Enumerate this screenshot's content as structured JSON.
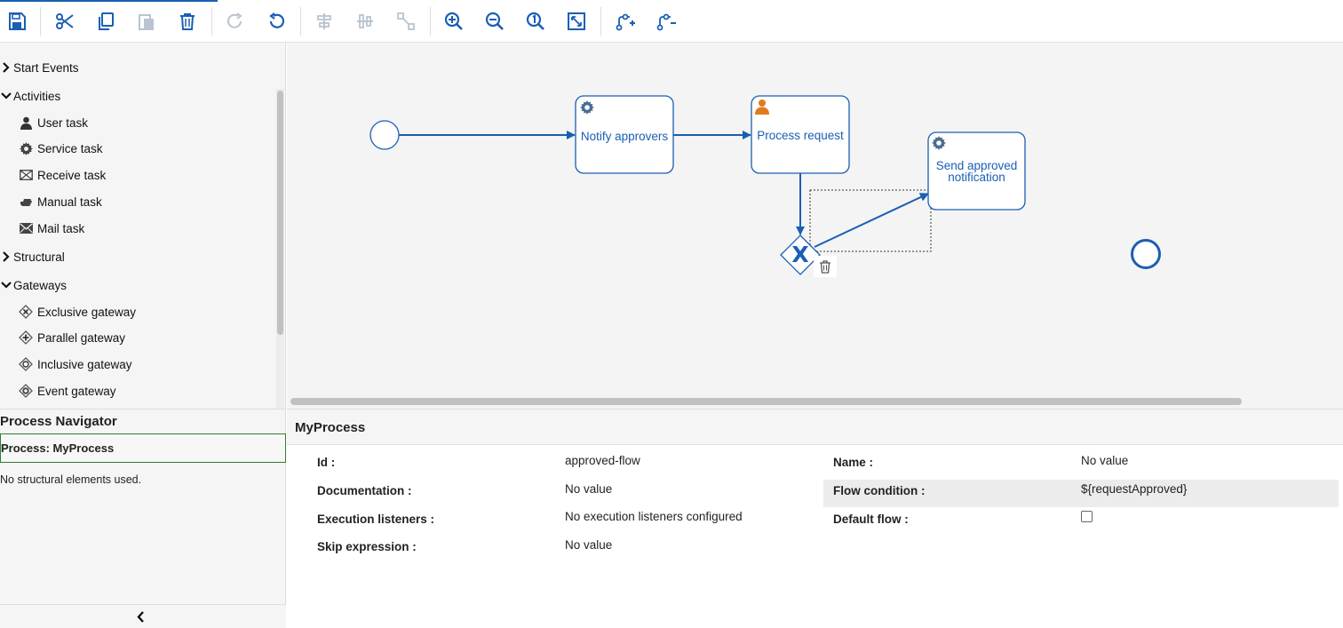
{
  "toolbar": {
    "buttons": [
      {
        "icon": "save-icon",
        "enabled": true
      },
      {
        "icon": "cut-icon",
        "enabled": true
      },
      {
        "icon": "copy-icon",
        "enabled": true
      },
      {
        "icon": "paste-icon",
        "enabled": false
      },
      {
        "icon": "delete-icon",
        "enabled": true
      },
      {
        "icon": "redo-icon",
        "enabled": false
      },
      {
        "icon": "undo-icon",
        "enabled": true
      },
      {
        "icon": "align-vertical-icon",
        "enabled": false
      },
      {
        "icon": "align-horizontal-icon",
        "enabled": false
      },
      {
        "icon": "same-size-icon",
        "enabled": false
      },
      {
        "icon": "zoom-in-icon",
        "enabled": true
      },
      {
        "icon": "zoom-out-icon",
        "enabled": true
      },
      {
        "icon": "zoom-actual-icon",
        "enabled": true
      },
      {
        "icon": "zoom-fit-icon",
        "enabled": true
      },
      {
        "icon": "add-bendpoint-icon",
        "enabled": true
      },
      {
        "icon": "remove-bendpoint-icon",
        "enabled": true
      }
    ],
    "accent_color": "#1a5fb4",
    "disabled_color": "#b9c4d0"
  },
  "palette": {
    "groups": [
      {
        "label": "Start Events",
        "expanded": false
      },
      {
        "label": "Activities",
        "expanded": true,
        "items": [
          {
            "label": "User task",
            "icon": "user-icon"
          },
          {
            "label": "Service task",
            "icon": "gear-icon"
          },
          {
            "label": "Receive task",
            "icon": "envelope-icon"
          },
          {
            "label": "Manual task",
            "icon": "hand-icon"
          },
          {
            "label": "Mail task",
            "icon": "mail-icon"
          }
        ]
      },
      {
        "label": "Structural",
        "expanded": false
      },
      {
        "label": "Gateways",
        "expanded": true,
        "items": [
          {
            "label": "Exclusive gateway",
            "icon": "exclusive-gateway-icon"
          },
          {
            "label": "Parallel gateway",
            "icon": "parallel-gateway-icon"
          },
          {
            "label": "Inclusive gateway",
            "icon": "inclusive-gateway-icon"
          },
          {
            "label": "Event gateway",
            "icon": "event-gateway-icon"
          }
        ]
      }
    ]
  },
  "diagram": {
    "tasks": [
      {
        "label": "Notify approvers",
        "type": "service"
      },
      {
        "label": "Process request",
        "type": "user"
      },
      {
        "label": "Send approved notification",
        "type": "service"
      }
    ],
    "gateway_marker": "X",
    "shape_color": "#1a5fb4",
    "user_icon_color": "#e07b1f"
  },
  "navigator": {
    "title": "Process Navigator",
    "process_label": "Process: MyProcess",
    "empty_text": "No structural elements used."
  },
  "properties": {
    "title": "MyProcess",
    "left": [
      {
        "label": "Id :",
        "value": "approved-flow"
      },
      {
        "label": "Documentation :",
        "value": "No value"
      },
      {
        "label": "Execution listeners :",
        "value": "No execution listeners configured"
      },
      {
        "label": "Skip expression :",
        "value": "No value"
      }
    ],
    "right": [
      {
        "label": "Name :",
        "value": "No value"
      },
      {
        "label": "Flow condition :",
        "value": "${requestApproved}"
      },
      {
        "label": "Default flow :",
        "value": ""
      }
    ],
    "default_flow_checked": false
  }
}
